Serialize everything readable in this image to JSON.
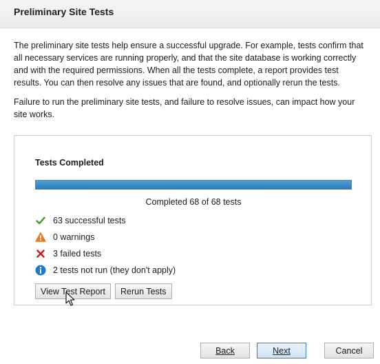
{
  "page": {
    "title": "Preliminary Site Tests",
    "intro_paragraph_1": "The preliminary site tests help ensure a successful upgrade. For example, tests confirm that all necessary services are running properly, and that the site database is working correctly and with the required permissions. When all the tests complete, a report provides test results. You can then resolve any issues that are found, and optionally rerun the tests.",
    "intro_paragraph_2": "Failure to run the preliminary site tests, and failure to resolve issues, can impact how your site works."
  },
  "tests": {
    "status_title": "Tests Completed",
    "progress_fraction": 1.0,
    "progress_text": "Completed 68 of 68 tests",
    "results": [
      {
        "icon": "check-icon",
        "label": "63 successful tests",
        "color": "#3c9a1e"
      },
      {
        "icon": "warning-icon",
        "label": "0 warnings",
        "color": "#e8791f"
      },
      {
        "icon": "error-x-icon",
        "label": "3 failed tests",
        "color": "#d4171d"
      },
      {
        "icon": "info-icon",
        "label": "2 tests not run (they don't apply)",
        "color": "#1f78c8"
      }
    ],
    "view_report_label": "View Test Report",
    "rerun_label": "Rerun Tests"
  },
  "footer": {
    "back_label": "Back",
    "next_label": "Next",
    "cancel_label": "Cancel"
  },
  "colors": {
    "progress_fill": "#2b7bbd",
    "primary_button_border": "#2f7fc8"
  }
}
